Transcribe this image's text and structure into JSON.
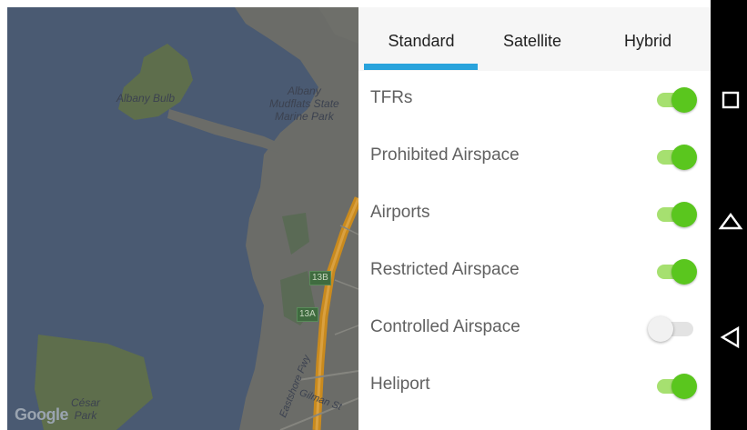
{
  "map": {
    "labels": {
      "albany_bulb": "Albany Bulb",
      "marine_park": "Albany\nMudflats State\nMarine Park",
      "cesar_park": "César\nPark",
      "eastshore_fwy": "Eastshore Fwy",
      "gilman_st": "Gilman St",
      "shield_13b": "13B",
      "shield_13a": "13A"
    },
    "google_logo": "Google",
    "colors": {
      "water": "#4a5a72",
      "land": "#6b6c68",
      "park": "#5e6e4c",
      "highway": "#c98a1e"
    }
  },
  "tabs": [
    {
      "label": "Standard",
      "selected": true
    },
    {
      "label": "Satellite",
      "selected": false
    },
    {
      "label": "Hybrid",
      "selected": false
    }
  ],
  "layers": [
    {
      "label": "TFRs",
      "enabled": true
    },
    {
      "label": "Prohibited Airspace",
      "enabled": true
    },
    {
      "label": "Airports",
      "enabled": true
    },
    {
      "label": "Restricted Airspace",
      "enabled": true
    },
    {
      "label": "Controlled Airspace",
      "enabled": false
    },
    {
      "label": "Heliport",
      "enabled": true
    }
  ],
  "colors": {
    "tab_indicator": "#29a3dc",
    "switch_on": "#5ac61e",
    "switch_on_track": "#a6e070"
  },
  "navbar": {
    "icons": [
      "recents-square-icon",
      "home-icon",
      "back-icon"
    ]
  }
}
